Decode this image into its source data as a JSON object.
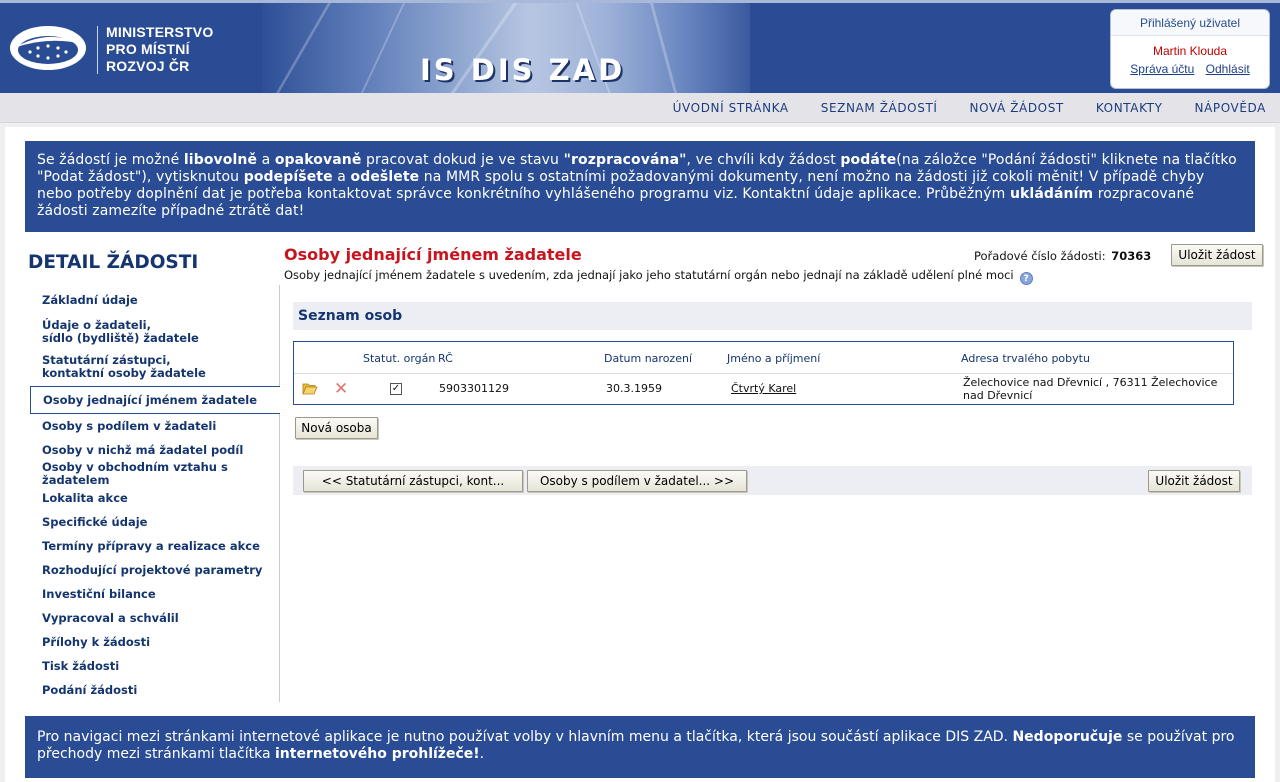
{
  "header": {
    "logo_lines": [
      "MINISTERSTVO",
      "PRO MÍSTNÍ",
      "ROZVOJ ČR"
    ],
    "app_title": "IS DIS ZAD",
    "user_box": {
      "title": "Přihlášený uživatel",
      "user_name": "Martin Klouda",
      "account_link": "Správa účtu",
      "logout_link": "Odhlásit"
    }
  },
  "nav": {
    "items": [
      "ÚVODNÍ STRÁNKA",
      "SEZNAM ŽÁDOSTÍ",
      "NOVÁ ŽÁDOST",
      "KONTAKTY",
      "NÁPOVĚDA"
    ]
  },
  "info_top": {
    "t1": "Se žádostí je možné ",
    "b1": "libovolně",
    "t2": " a ",
    "b2": "opakovaně",
    "t3": " pracovat dokud je ve stavu ",
    "b3": "\"rozpracována\"",
    "t4": ", ve chvíli kdy žádost ",
    "b4": "podáte",
    "t5": "(na záložce \"Podání žádosti\" kliknete na tlačítko \"Podat žádost\"), vytisknutou ",
    "b5": "podepíšete",
    "t6": " a ",
    "b6": "odešlete",
    "t7": " na MMR spolu s ostatními požadovanými dokumenty, není možno na žádosti již cokoli měnit! V případě chyby nebo potřeby doplnění dat je potřeba kontaktovat správce konkrétního vyhlášeného programu viz. Kontaktní údaje aplikace. Průběžným ",
    "b7": "ukládáním",
    "t8": " rozpracované žádosti zamezíte případné ztrátě dat!"
  },
  "sidebar": {
    "title": "DETAIL ŽÁDOSTI",
    "items": [
      {
        "line1": "Základní údaje",
        "line2": ""
      },
      {
        "line1": "Údaje o žadateli,",
        "line2": "sídlo (bydliště) žadatele"
      },
      {
        "line1": "Statutární zástupci,",
        "line2": "kontaktní osoby žadatele"
      },
      {
        "line1": "Osoby jednající jménem žadatele",
        "line2": ""
      },
      {
        "line1": "Osoby s podílem v žadateli",
        "line2": ""
      },
      {
        "line1": "Osoby v nichž má žadatel podíl",
        "line2": ""
      },
      {
        "line1": "Osoby v obchodním vztahu s žadatelem",
        "line2": ""
      },
      {
        "line1": "Lokalita akce",
        "line2": ""
      },
      {
        "line1": "Specifické údaje",
        "line2": ""
      },
      {
        "line1": "Termíny přípravy a realizace akce",
        "line2": ""
      },
      {
        "line1": "Rozhodující projektové parametry",
        "line2": ""
      },
      {
        "line1": "Investiční bilance",
        "line2": ""
      },
      {
        "line1": "Vypracoval a schválil",
        "line2": ""
      },
      {
        "line1": "Přílohy k žádosti",
        "line2": ""
      },
      {
        "line1": "Tisk žádosti",
        "line2": ""
      },
      {
        "line1": "Podání žádosti",
        "line2": ""
      }
    ]
  },
  "main": {
    "title": "Osoby jednající jménem žadatele",
    "subtitle": "Osoby jednající jménem žadatele s uvedením, zda jednají jako jeho statutární orgán nebo jednají na základě udělení plné moci",
    "order_label": "Pořadové číslo žádosti:",
    "order_number": "70363",
    "save_label": "Uložit žádost",
    "section_title": "Seznam osob",
    "table": {
      "headers": {
        "statutory": "Statut. orgán",
        "rc": "RČ",
        "birth_date": "Datum narození",
        "name": "Jméno a příjmení",
        "address": "Adresa trvalého pobytu"
      },
      "rows": [
        {
          "statutory": "✓",
          "rc": "5903301129",
          "birth_date": "30.3.1959",
          "name": "Čtvrtý Karel",
          "address_line1": "Želechovice nad Dřevnicí , 76311 Želechovice",
          "address_line2": "nad Dřevnicí"
        }
      ]
    },
    "new_person_label": "Nová osoba",
    "prev_label": "<<  Statutární zástupci, kont...",
    "next_label": "Osoby s podílem v žadatel...  >>",
    "save_bottom_label": "Uložit žádost"
  },
  "info_bottom": {
    "t1": "Pro navigaci mezi stránkami internetové aplikace je nutno používat volby v hlavním menu a tlačítka, která jsou součástí aplikace DIS ZAD. ",
    "b1": "Nedoporučuje",
    "t2": " se používat pro přechody mezi stránkami tlačítka ",
    "b2": "internetového prohlížeče!",
    "t3": "."
  }
}
